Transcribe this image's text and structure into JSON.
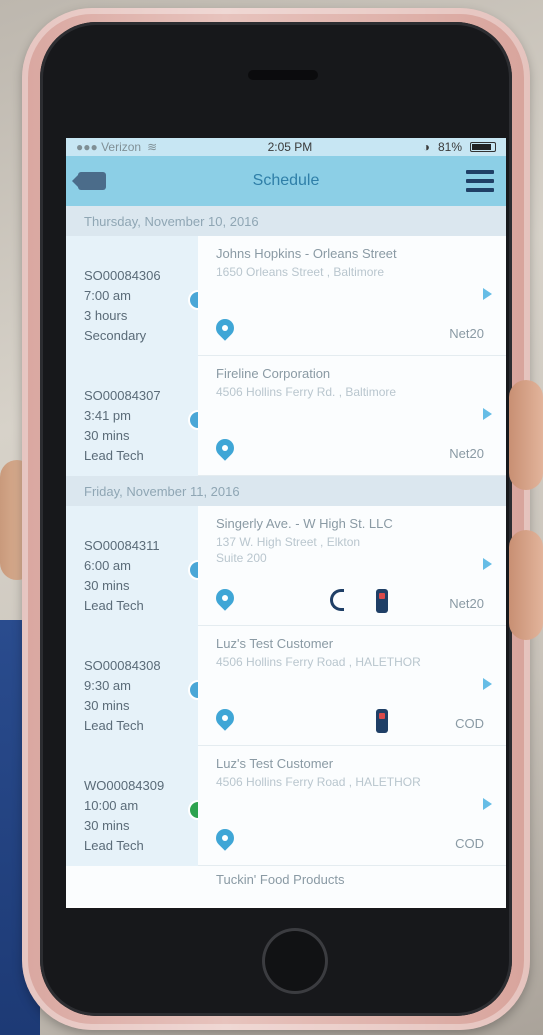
{
  "status_bar": {
    "carrier": "●●● Verizon",
    "time": "2:05 PM",
    "battery": "81%"
  },
  "nav": {
    "title": "Schedule"
  },
  "sections": [
    {
      "date": "Thursday, November 10, 2016",
      "jobs": [
        {
          "order": "SO00084306",
          "time": "7:00 am",
          "duration": "3 hours",
          "role": "Secondary",
          "customer": "Johns Hopkins - Orleans Street",
          "address": "1650 Orleans Street , Baltimore",
          "address2": "",
          "terms": "Net20",
          "status_color": "#4aa7d7"
        },
        {
          "order": "SO00084307",
          "time": "3:41 pm",
          "duration": "30 mins",
          "role": "Lead Tech",
          "customer": "Fireline Corporation",
          "address": "4506 Hollins Ferry Rd. , Baltimore",
          "address2": "",
          "terms": "Net20",
          "status_color": "#4aa7d7"
        }
      ]
    },
    {
      "date": "Friday, November 11, 2016",
      "jobs": [
        {
          "order": "SO00084311",
          "time": "6:00 am",
          "duration": "30 mins",
          "role": "Lead Tech",
          "customer": "Singerly Ave. - W High St. LLC",
          "address": "137 W. High Street , Elkton",
          "address2": "Suite 200",
          "terms": "Net20",
          "status_color": "#4aa7d7"
        },
        {
          "order": "SO00084308",
          "time": "9:30 am",
          "duration": "30 mins",
          "role": "Lead Tech",
          "customer": "Luz's Test Customer",
          "address": "4506 Hollins Ferry Road , HALETHOR",
          "address2": "",
          "terms": "COD",
          "status_color": "#4aa7d7"
        },
        {
          "order": "WO00084309",
          "time": "10:00 am",
          "duration": "30 mins",
          "role": "Lead Tech",
          "customer": "Luz's Test Customer",
          "address": "4506 Hollins Ferry Road , HALETHOR",
          "address2": "",
          "terms": "COD",
          "status_color": "#2ea34f"
        }
      ]
    }
  ],
  "partial_next": "Tuckin' Food Products"
}
